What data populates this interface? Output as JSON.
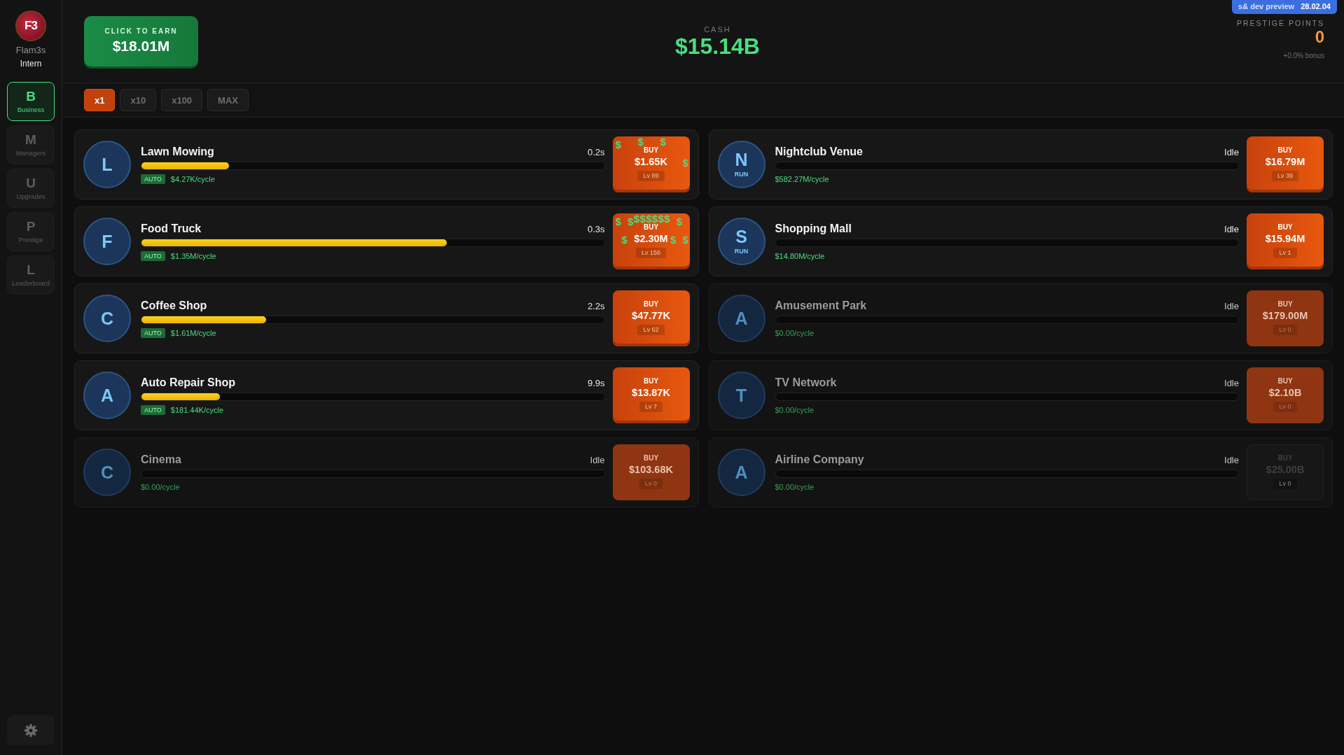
{
  "player": {
    "avatar_text": "F3",
    "name": "Flam3s",
    "rank": "Intern"
  },
  "nav": [
    {
      "letter": "B",
      "label": "Business",
      "selected": true
    },
    {
      "letter": "M",
      "label": "Managers",
      "selected": false
    },
    {
      "letter": "U",
      "label": "Upgrades",
      "selected": false
    },
    {
      "letter": "P",
      "label": "Prestige",
      "selected": false
    },
    {
      "letter": "L",
      "label": "Leaderboard",
      "selected": false
    }
  ],
  "click_button": {
    "label": "CLICK TO EARN",
    "amount": "$18.01M"
  },
  "cash": {
    "label": "CASH",
    "amount": "$15.14B"
  },
  "prestige": {
    "label": "PRESTIGE POINTS",
    "value": "0",
    "bonus": "+0.0% bonus"
  },
  "build_badge": {
    "label": "s& dev preview",
    "version": "28.02.04"
  },
  "multipliers": [
    {
      "label": "x1",
      "selected": true
    },
    {
      "label": "x10",
      "selected": false
    },
    {
      "label": "x100",
      "selected": false
    },
    {
      "label": "MAX",
      "selected": false
    }
  ],
  "businesses": [
    {
      "letter": "L",
      "name": "Lawn Mowing",
      "status": "0.2s",
      "level": 0.19,
      "manager": {
        "kind": "auto",
        "label": "AUTO"
      },
      "income": "$4.27K/cycle",
      "owned": true,
      "buy": {
        "label": "BUY",
        "price": "$1.65K",
        "lv": "Lv 89",
        "affordable": true
      },
      "floating_coins": [
        "$",
        "$",
        "$",
        "$"
      ]
    },
    {
      "letter": "F",
      "name": "Food Truck",
      "status": "0.3s",
      "level": 0.66,
      "manager": {
        "kind": "auto",
        "label": "AUTO"
      },
      "income": "$1.35M/cycle",
      "owned": true,
      "buy": {
        "label": "BUY",
        "price": "$2.30M",
        "lv": "Lv 156",
        "affordable": true
      },
      "floating_coins": [
        "$",
        "$",
        "$",
        "$",
        "$",
        "$",
        "$",
        "$",
        "$",
        "$",
        "$",
        "$"
      ]
    },
    {
      "letter": "C",
      "name": "Coffee Shop",
      "status": "2.2s",
      "level": 0.27,
      "manager": {
        "kind": "auto",
        "label": "AUTO"
      },
      "income": "$1.61M/cycle",
      "owned": true,
      "buy": {
        "label": "BUY",
        "price": "$47.77K",
        "lv": "Lv 62",
        "affordable": true
      }
    },
    {
      "letter": "A",
      "name": "Auto Repair Shop",
      "status": "9.9s",
      "level": 0.17,
      "manager": {
        "kind": "auto",
        "label": "AUTO"
      },
      "income": "$181.44K/cycle",
      "owned": true,
      "buy": {
        "label": "BUY",
        "price": "$13.87K",
        "lv": "Lv 7",
        "affordable": true
      }
    },
    {
      "letter": "C",
      "name": "Cinema",
      "status": "Idle",
      "income": "$0.00/cycle",
      "owned": false,
      "buy": {
        "label": "BUY",
        "price": "$103.68K",
        "lv": "Lv 0",
        "affordable": true
      }
    },
    {
      "letter": "N",
      "name": "Nightclub Venue",
      "status": "Idle",
      "manager": {
        "kind": "run",
        "label": "RUN"
      },
      "income": "$582.27M/cycle",
      "owned": true,
      "buy": {
        "label": "BUY",
        "price": "$16.79M",
        "lv": "Lv 39",
        "affordable": true
      }
    },
    {
      "letter": "S",
      "name": "Shopping Mall",
      "status": "Idle",
      "manager": {
        "kind": "run",
        "label": "RUN"
      },
      "income": "$14.80M/cycle",
      "owned": true,
      "buy": {
        "label": "BUY",
        "price": "$15.94M",
        "lv": "Lv 1",
        "affordable": true
      }
    },
    {
      "letter": "A",
      "name": "Amusement Park",
      "status": "Idle",
      "income": "$0.00/cycle",
      "owned": false,
      "buy": {
        "label": "BUY",
        "price": "$179.00M",
        "lv": "Lv 0",
        "affordable": true
      }
    },
    {
      "letter": "T",
      "name": "TV Network",
      "status": "Idle",
      "income": "$0.00/cycle",
      "owned": false,
      "buy": {
        "label": "BUY",
        "price": "$2.10B",
        "lv": "Lv 0",
        "affordable": true
      }
    },
    {
      "letter": "A",
      "name": "Airline Company",
      "status": "Idle",
      "income": "$0.00/cycle",
      "owned": false,
      "buy": {
        "label": "BUY",
        "price": "$25.00B",
        "lv": "Lv 0",
        "affordable": false
      }
    }
  ]
}
